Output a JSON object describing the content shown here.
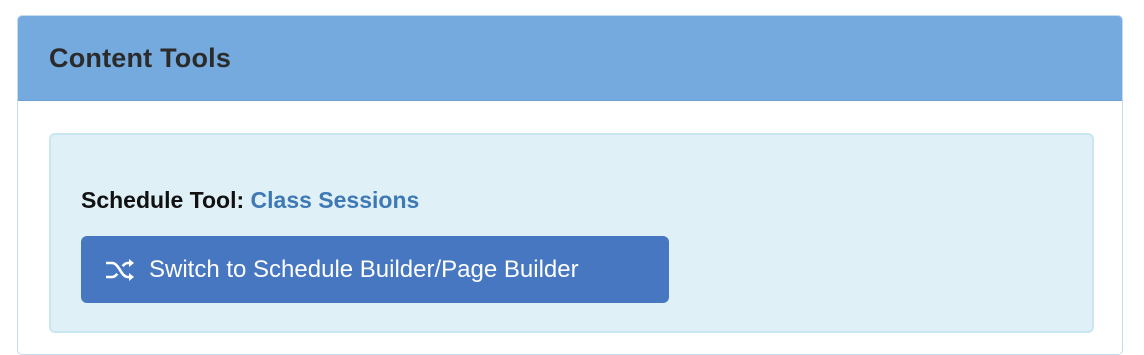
{
  "panel": {
    "title": "Content Tools"
  },
  "schedule_tool": {
    "label": "Schedule Tool:",
    "link_text": "Class Sessions"
  },
  "switch_button": {
    "icon": "shuffle-icon",
    "label": "Switch to Schedule Builder/Page Builder"
  },
  "colors": {
    "heading_bg": "#74aadd",
    "info_bg": "#dff0f7",
    "button_bg": "#4677c0",
    "link": "#3f79b5"
  }
}
